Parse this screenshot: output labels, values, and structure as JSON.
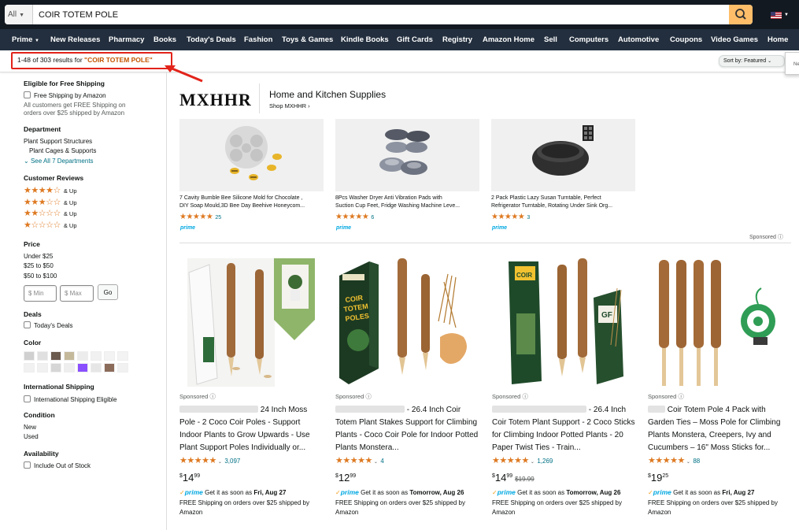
{
  "search": {
    "category": "All",
    "query": "COIR TOTEM POLE"
  },
  "nav": [
    "Prime",
    "New Releases",
    "Pharmacy",
    "Books",
    "Today's Deals",
    "Fashion",
    "Toys & Games",
    "Kindle Books",
    "Gift Cards",
    "Registry",
    "Amazon Home",
    "Sell",
    "Computers",
    "Automotive",
    "Coupons",
    "Video Games",
    "Home"
  ],
  "results": {
    "prefix": "1-48 of 303 results for ",
    "query": "\"COIR TOTEM POLE\"",
    "sort_label": "Sort by:",
    "sort_value": "Featured",
    "popover_text": "Ne"
  },
  "sidebar": {
    "shipping": {
      "heading": "Eligible for Free Shipping",
      "option": "Free Shipping by Amazon",
      "note1": "All customers get FREE Shipping on",
      "note2": "orders over $25 shipped by Amazon"
    },
    "department": {
      "heading": "Department",
      "item1": "Plant Support Structures",
      "item2": "Plant Cages & Supports",
      "see_all": "See All 7 Departments"
    },
    "reviews": {
      "heading": "Customer Reviews",
      "rows": [
        {
          "stars": 4,
          "label": "& Up"
        },
        {
          "stars": 3,
          "label": "& Up"
        },
        {
          "stars": 2,
          "label": "& Up"
        },
        {
          "stars": 1,
          "label": "& Up"
        }
      ]
    },
    "price": {
      "heading": "Price",
      "ranges": [
        "Under $25",
        "$25 to $50",
        "$50 to $100"
      ],
      "min_placeholder": "$ Min",
      "max_placeholder": "$ Max",
      "go": "Go"
    },
    "deals": {
      "heading": "Deals",
      "option": "Today's Deals"
    },
    "color": {
      "heading": "Color",
      "swatches": [
        "#d0d0d0",
        "#e0e0e0",
        "#6b5a4e",
        "#c5b99b",
        "#ececec",
        "#f1f1f1",
        "#f3f3f3",
        "#f3f3f3",
        "#f1f1f1",
        "#f1f1f1",
        "#d6d6d6",
        "#eeeeee",
        "#8a4fff",
        "#e6e6e6",
        "#8b6b5a",
        "#f1f1f1"
      ]
    },
    "intl": {
      "heading": "International Shipping",
      "option": "International Shipping Eligible"
    },
    "condition": {
      "heading": "Condition",
      "options": [
        "New",
        "Used"
      ]
    },
    "availability": {
      "heading": "Availability",
      "option": "Include Out of Stock"
    }
  },
  "brand": {
    "logo": "MXHHR",
    "title": "Home and Kitchen Supplies",
    "shop": "Shop MXHHR ›",
    "sponsored": "Sponsored"
  },
  "brand_products": [
    {
      "line1": "7 Cavity Bumble Bee Silicone Mold for Chocolate ,",
      "line2": "DIY Soap Mould,3D Bee Day Beehive Honeycom...",
      "rating": 4.5,
      "count": "25",
      "prime": "prime"
    },
    {
      "line1": "8Pcs Washer Dryer Anti Vibration Pads with",
      "line2": "Suction Cup Feet, Fridge Washing Machine Leve...",
      "rating": 4.5,
      "count": "6",
      "prime": "prime"
    },
    {
      "line1": "2 Pack Plastic Lazy Susan Turntable, Perfect",
      "line2": "Refrigerator Turntable, Rotating Under Sink Org...",
      "rating": 5,
      "count": "3",
      "prime": "prime"
    }
  ],
  "products": [
    {
      "sponsored": "Sponsored",
      "title_start": "24 Inch Moss",
      "title_rest": "Pole - 2 Coco Coir Poles - Support Indoor Plants to Grow Upwards - Use Plant Support Poles Individually or...",
      "rating": 4.5,
      "count": "3,097",
      "price_whole": "14",
      "price_frac": "99",
      "was": "",
      "prime": "prime",
      "delivery_text": "Get it as soon as",
      "delivery_date": "Fri, Aug 27",
      "shipping": "FREE Shipping on orders over $25 shipped by Amazon"
    },
    {
      "sponsored": "Sponsored",
      "title_start": "- 26.4 Inch Coir",
      "title_rest": "Totem Plant Stakes Support for Climbing Plants - Coco Coir Pole for Indoor Potted Plants Monstera...",
      "rating": 5,
      "count": "4",
      "price_whole": "12",
      "price_frac": "99",
      "was": "",
      "prime": "prime",
      "delivery_text": "Get it as soon as",
      "delivery_date": "Tomorrow, Aug 26",
      "shipping": "FREE Shipping on orders over $25 shipped by Amazon"
    },
    {
      "sponsored": "Sponsored",
      "title_start": "- 26.4 Inch",
      "title_rest": "Coir Totem Plant Support - 2 Coco Sticks for Climbing Indoor Potted Plants - 20 Paper Twist Ties - Train...",
      "rating": 4.5,
      "count": "1,269",
      "price_whole": "14",
      "price_frac": "99",
      "was": "$19.99",
      "prime": "prime",
      "delivery_text": "Get it as soon as",
      "delivery_date": "Tomorrow, Aug 26",
      "shipping": "FREE Shipping on orders over $25 shipped by Amazon"
    },
    {
      "sponsored": "Sponsored",
      "title_start": "Coir Totem Pole 4 Pack with",
      "title_rest": "Garden Ties – Moss Pole for Climbing Plants Monstera, Creepers, Ivy and Cucumbers – 16\" Moss Sticks for...",
      "rating": 4.5,
      "count": "88",
      "price_whole": "19",
      "price_frac": "25",
      "was": "",
      "prime": "prime",
      "delivery_text": "Get it as soon as",
      "delivery_date": "Fri, Aug 27",
      "shipping": "FREE Shipping on orders over $25 shipped by Amazon"
    }
  ],
  "colors": {
    "header": "#131921",
    "nav": "#232f3e",
    "search_button": "#febd69",
    "accent_link": "#007185",
    "star": "#de7921",
    "prime": "#00a8e1",
    "highlight_box": "#e2231a"
  }
}
